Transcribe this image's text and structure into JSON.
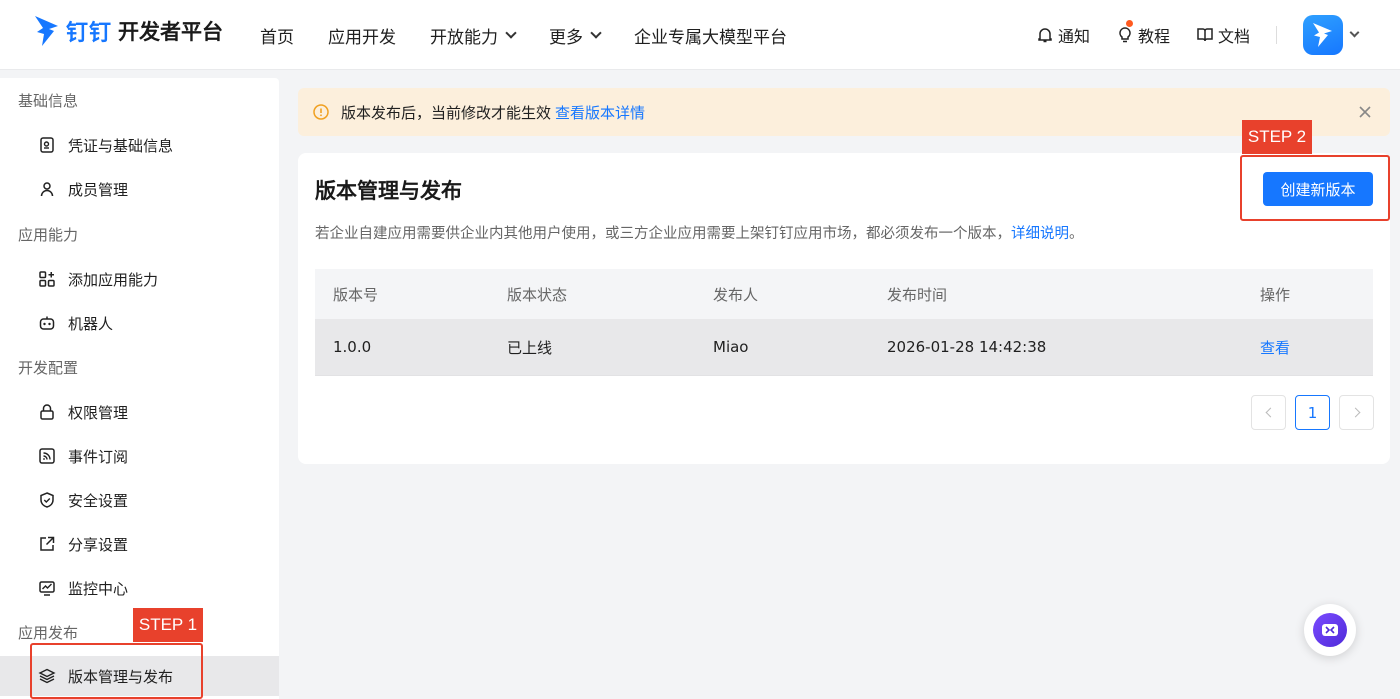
{
  "header": {
    "brand": "钉钉",
    "product": "开发者平台",
    "nav": [
      {
        "label": "首页"
      },
      {
        "label": "应用开发"
      },
      {
        "label": "开放能力"
      },
      {
        "label": "更多"
      },
      {
        "label": "企业专属大模型平台"
      }
    ],
    "tools": {
      "notify": "通知",
      "tutorial": "教程",
      "docs": "文档"
    }
  },
  "sidebar": {
    "groups": [
      {
        "title": "基础信息"
      },
      {
        "title": "应用能力"
      },
      {
        "title": "开发配置"
      },
      {
        "title": "应用发布"
      }
    ],
    "items": [
      {
        "label": "凭证与基础信息"
      },
      {
        "label": "成员管理"
      },
      {
        "label": "添加应用能力"
      },
      {
        "label": "机器人"
      },
      {
        "label": "权限管理"
      },
      {
        "label": "事件订阅"
      },
      {
        "label": "安全设置"
      },
      {
        "label": "分享设置"
      },
      {
        "label": "监控中心"
      },
      {
        "label": "版本管理与发布"
      }
    ]
  },
  "alert": {
    "text": "版本发布后，当前修改才能生效",
    "link": "查看版本详情"
  },
  "card": {
    "title": "版本管理与发布",
    "desc": "若企业自建应用需要供企业内其他用户使用，或三方企业应用需要上架钉钉应用市场，都必须发布一个版本，",
    "desc_link": "详细说明",
    "desc_end": "。",
    "create_button": "创建新版本"
  },
  "table": {
    "columns": [
      "版本号",
      "版本状态",
      "发布人",
      "发布时间",
      "操作"
    ],
    "rows": [
      {
        "version": "1.0.0",
        "status": "已上线",
        "publisher": "Miao",
        "time": "2026-01-28 14:42:38",
        "action": "查看"
      }
    ]
  },
  "pagination": {
    "current": "1"
  },
  "steps": {
    "step1": "STEP 1",
    "step2": "STEP 2"
  },
  "colors": {
    "accent": "#1677ff",
    "annotation": "#e8412c",
    "alert_bg": "#fcefdc"
  }
}
